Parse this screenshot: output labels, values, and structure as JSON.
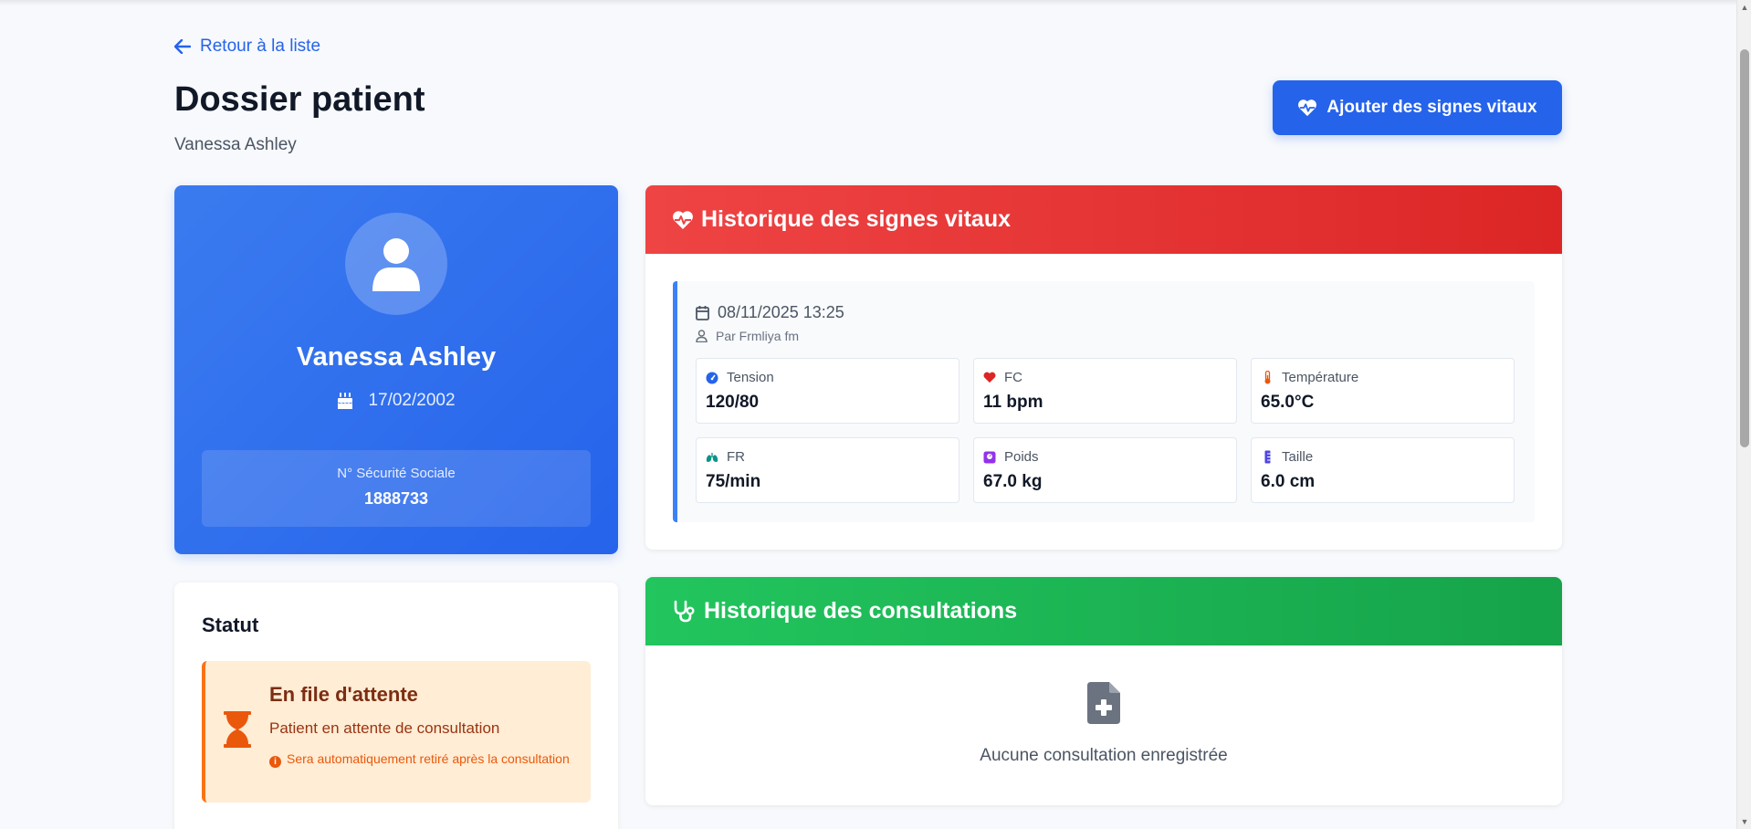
{
  "nav": {
    "back_label": "Retour à la liste"
  },
  "header": {
    "title": "Dossier patient",
    "subtitle": "Vanessa Ashley",
    "add_vitals_label": "Ajouter des signes vitaux"
  },
  "patient": {
    "name": "Vanessa Ashley",
    "dob": "17/02/2002",
    "ssn_label": "N° Sécurité Sociale",
    "ssn_value": "1888733"
  },
  "status": {
    "title": "Statut",
    "queue_title": "En file d'attente",
    "queue_desc": "Patient en attente de consultation",
    "queue_note": "Sera automatiquement retiré après la consultation"
  },
  "vitals": {
    "title": "Historique des signes vitaux",
    "entries": [
      {
        "date": "08/11/2025 13:25",
        "author": "Par Frmliya fm",
        "items": [
          {
            "label": "Tension",
            "value": "120/80",
            "icon": "gauge-icon",
            "color": "#2563eb"
          },
          {
            "label": "FC",
            "value": "11 bpm",
            "icon": "heart-icon",
            "color": "#dc2626"
          },
          {
            "label": "Température",
            "value": "65.0°C",
            "icon": "thermometer-icon",
            "color": "#ea580c"
          },
          {
            "label": "FR",
            "value": "75/min",
            "icon": "lungs-icon",
            "color": "#0d9488"
          },
          {
            "label": "Poids",
            "value": "67.0 kg",
            "icon": "weight-icon",
            "color": "#9333ea"
          },
          {
            "label": "Taille",
            "value": "6.0 cm",
            "icon": "ruler-icon",
            "color": "#4f46e5"
          }
        ]
      }
    ]
  },
  "consultations": {
    "title": "Historique des consultations",
    "empty_text": "Aucune consultation enregistrée"
  },
  "colors": {
    "primary": "#2563eb",
    "vitals_header": "#ef4444",
    "consult_header": "#22c55e",
    "queue_accent": "#f97316"
  }
}
